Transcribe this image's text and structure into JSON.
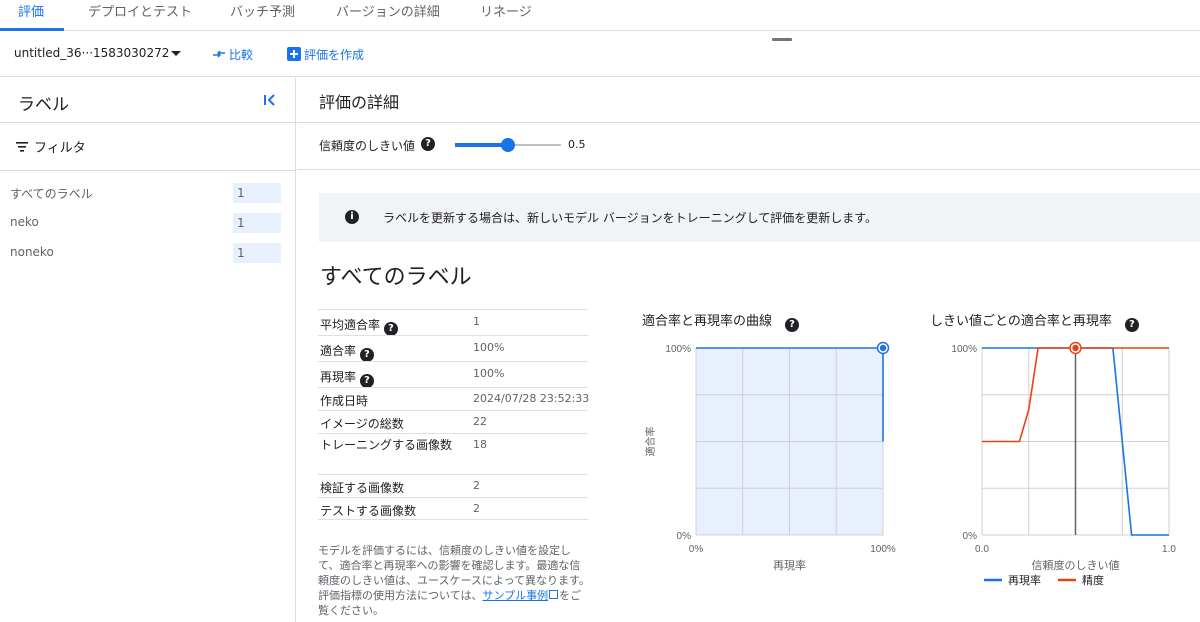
{
  "tabs": [
    {
      "label": "評価",
      "active": true
    },
    {
      "label": "デプロイとテスト"
    },
    {
      "label": "バッチ予測"
    },
    {
      "label": "バージョンの詳細"
    },
    {
      "label": "リネージ"
    }
  ],
  "toolbar": {
    "model_name": "untitled_36···1583030272",
    "compare_label": "比較",
    "create_eval_label": "評価を作成"
  },
  "sidebar": {
    "title": "ラベル",
    "filter_label": "フィルタ",
    "labels": [
      {
        "name": "すべてのラベル",
        "count": "1"
      },
      {
        "name": "neko",
        "count": "1"
      },
      {
        "name": "noneko",
        "count": "1"
      }
    ]
  },
  "main": {
    "title": "評価の詳細",
    "threshold_label": "信頼度のしきい値",
    "threshold_value": "0.5",
    "info_text": "ラベルを更新する場合は、新しいモデル バージョンをトレーニングして評価を更新します。",
    "section_title": "すべてのラベル",
    "metrics": [
      {
        "name": "平均適合率",
        "value": "1",
        "help": true
      },
      {
        "name": "適合率",
        "value": "100%",
        "help": true
      },
      {
        "name": "再現率",
        "value": "100%",
        "help": true
      },
      {
        "name": "作成日時",
        "value": "2024/07/28 23:52:33"
      },
      {
        "name": "イメージの総数",
        "value": "22"
      },
      {
        "name": "トレーニングする画像数",
        "value": "18"
      },
      {
        "name": "検証する画像数",
        "value": "2"
      },
      {
        "name": "テストする画像数",
        "value": "2"
      }
    ],
    "description_before": "モデルを評価するには、信頼度のしきい値を設定して、適合率と再現率への影響を確認します。最適な信頼度のしきい値は、ユースケースによって異なります。評価指標の使用方法については、",
    "description_link": "サンプル事例",
    "description_after": "をご覧ください。"
  },
  "chart_data": [
    {
      "type": "line",
      "title": "適合率と再現率の曲線",
      "xlabel": "再現率",
      "ylabel": "適合率",
      "x_ticks": [
        "0%",
        "100%"
      ],
      "y_ticks": [
        "0%",
        "100%"
      ],
      "xlim": [
        0,
        1
      ],
      "ylim": [
        0,
        1
      ],
      "grid": true,
      "series": [
        {
          "color": "#1a73e8",
          "x": [
            0,
            1,
            1
          ],
          "y": [
            1,
            1,
            0.5
          ],
          "area_fill": "#e8f0fe"
        }
      ],
      "marker": {
        "x": 1,
        "y": 1
      }
    },
    {
      "type": "line",
      "title": "しきい値ごとの適合率と再現率",
      "xlabel": "信頼度のしきい値",
      "x_ticks": [
        "0.0",
        "1.0"
      ],
      "y_ticks": [
        "0%",
        "100%"
      ],
      "xlim": [
        0,
        1
      ],
      "ylim": [
        0,
        1
      ],
      "grid": true,
      "threshold": 0.5,
      "legend_position": "bottom",
      "series": [
        {
          "name": "再現率",
          "color": "#1a73e8",
          "x": [
            0,
            0.7,
            0.8,
            1.0
          ],
          "y": [
            1,
            1,
            0,
            0
          ]
        },
        {
          "name": "精度",
          "color": "#e8430f",
          "x": [
            0,
            0.2,
            0.25,
            0.3,
            1.0
          ],
          "y": [
            0.5,
            0.5,
            0.67,
            1,
            1
          ]
        }
      ],
      "marker": {
        "x": 0.5,
        "y": 1
      }
    }
  ],
  "colors": {
    "accent": "#1a73e8",
    "recall": "#1a73e8",
    "precision": "#e8430f"
  }
}
